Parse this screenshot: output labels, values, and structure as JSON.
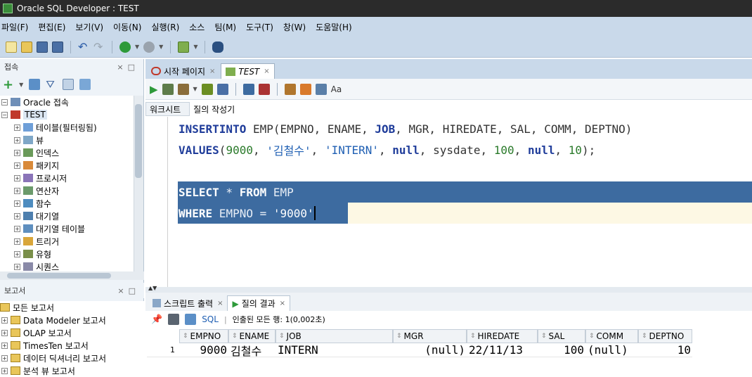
{
  "window": {
    "title": "Oracle SQL Developer : TEST"
  },
  "menu": [
    "파일(F)",
    "편집(E)",
    "보기(V)",
    "이동(N)",
    "실행(R)",
    "소스",
    "팀(M)",
    "도구(T)",
    "창(W)",
    "도움말(H)"
  ],
  "connections_panel": {
    "title": "접속",
    "root": "Oracle 접속",
    "connection": "TEST",
    "items": [
      "테이블(필터링됨)",
      "뷰",
      "인덱스",
      "패키지",
      "프로시저",
      "연산자",
      "함수",
      "대기열",
      "대기열 테이블",
      "트리거",
      "유형",
      "시퀀스"
    ]
  },
  "reports_panel": {
    "title": "보고서",
    "items": [
      "모든 보고서",
      "Data Modeler 보고서",
      "OLAP 보고서",
      "TimesTen 보고서",
      "데이터 딕셔너리 보고서",
      "분석 뷰 보고서"
    ]
  },
  "editor_tabs": [
    "시작 페이지",
    "TEST"
  ],
  "editor_subtabs": [
    "워크시트",
    "질의 작성기"
  ],
  "code": {
    "line1": {
      "kw1": "INSERT",
      "kw2": "INTO",
      "rest1": " EMP(EMPNO, ENAME, ",
      "kw3": "JOB",
      "rest2": ", MGR, HIREDATE, SAL, COMM, DEPTNO)"
    },
    "line2": {
      "kw1": "VALUES",
      "p1": "(",
      "n1": "9000",
      "c1": ", ",
      "s1": "'김철수'",
      "c2": ", ",
      "s2": "'INTERN'",
      "c3": ", ",
      "kw2": "null",
      "c4": ", sysdate, ",
      "n2": "100",
      "c5": ", ",
      "kw3": "null",
      "c6": ", ",
      "n3": "10",
      "c7": ");"
    },
    "line3": {
      "kw1": "SELECT",
      "mid": " * ",
      "kw2": "FROM",
      "rest": " EMP"
    },
    "line4": {
      "kw1": "WHERE",
      "rest": " EMPNO = ",
      "s1": "'9000'"
    }
  },
  "result_tabs": [
    "스크립트 출력",
    "질의 결과"
  ],
  "result_toolbar": {
    "sql_link": "SQL",
    "status": "인출된 모든 행: 1(0,002초)"
  },
  "grid": {
    "columns": [
      "EMPNO",
      "ENAME",
      "JOB",
      "MGR",
      "HIREDATE",
      "SAL",
      "COMM",
      "DEPTNO"
    ],
    "row": {
      "num": "1",
      "EMPNO": "9000",
      "ENAME": "김철수",
      "JOB": "INTERN",
      "MGR": "(null)",
      "HIREDATE": "22/11/13",
      "SAL": "100",
      "COMM": "(null)",
      "DEPTNO": "10"
    }
  }
}
